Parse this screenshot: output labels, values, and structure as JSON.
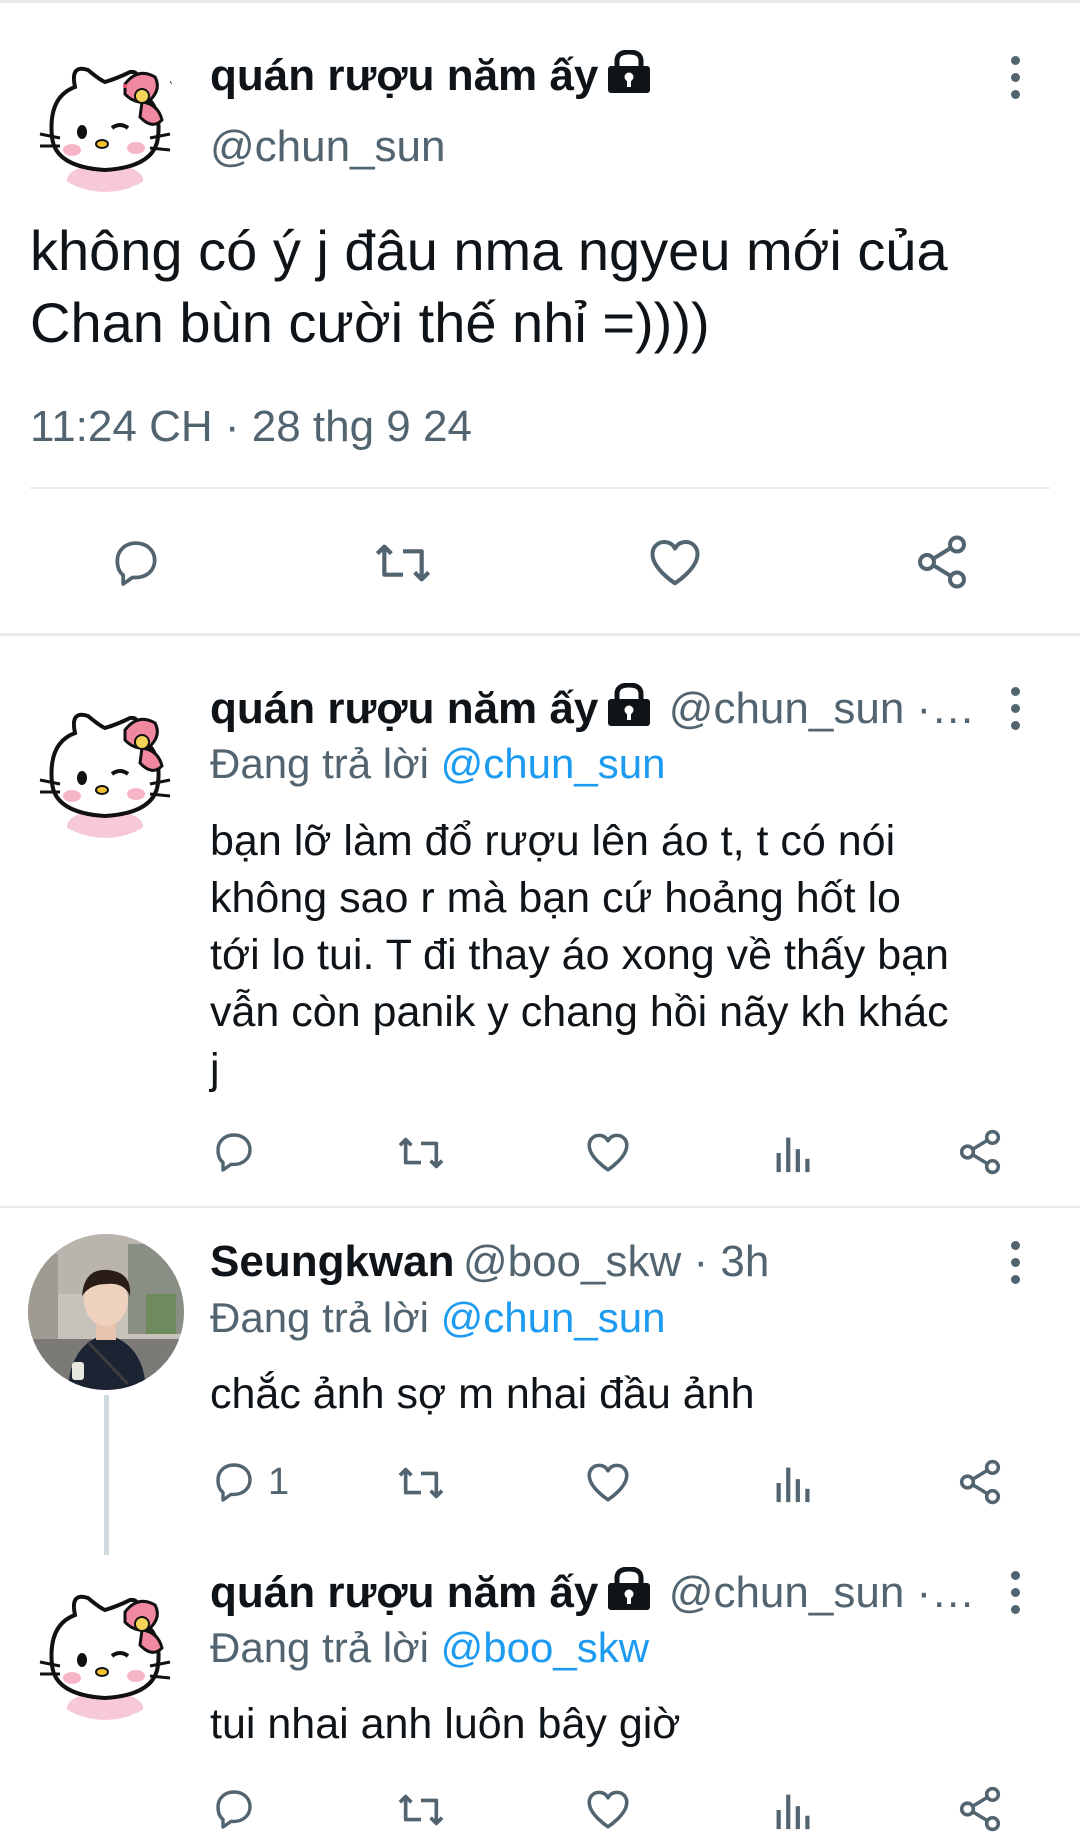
{
  "main_tweet": {
    "display_name": "quán rượu năm ấy",
    "handle": "@chun_sun",
    "text_line1": "không có ý j đâu nma ngyeu mới của",
    "text_line2": "Chan bùn cười thế nhỉ =))))",
    "timestamp": "11:24 CH · 28 thg 9 24"
  },
  "replies": [
    {
      "display_name": "quán rượu năm ấy",
      "handle_time": "@chun_sun ·…",
      "replying_prefix": "Đang trả lời ",
      "replying_to": "@chun_sun",
      "text_lines": [
        "bạn lỡ làm đổ rượu lên áo t, t có nói",
        "không sao r mà bạn cứ hoảng hốt lo",
        "tới lo tui. T đi thay áo xong về thấy bạn",
        "vẫn còn panik y chang hồi nãy kh khác",
        "j"
      ],
      "reply_count": ""
    },
    {
      "display_name": "Seungkwan",
      "handle_time": "@boo_skw · 3h",
      "replying_prefix": "Đang trả lời ",
      "replying_to": "@chun_sun",
      "text_lines": [
        "chắc ảnh sợ m nhai đầu ảnh"
      ],
      "reply_count": "1"
    },
    {
      "display_name": "quán rượu năm ấy",
      "handle_time": "@chun_sun ·…",
      "replying_prefix": "Đang trả lời ",
      "replying_to": "@boo_skw",
      "text_lines": [
        "tui nhai anh luôn bây giờ"
      ],
      "reply_count": ""
    }
  ],
  "colors": {
    "accent": "#1d9bf0",
    "text": "#0f1419",
    "secondary": "#536471",
    "divider": "#e6ecf0"
  },
  "icons": [
    "lock-icon",
    "more-icon",
    "reply-icon",
    "retweet-icon",
    "like-icon",
    "views-icon",
    "share-icon"
  ]
}
